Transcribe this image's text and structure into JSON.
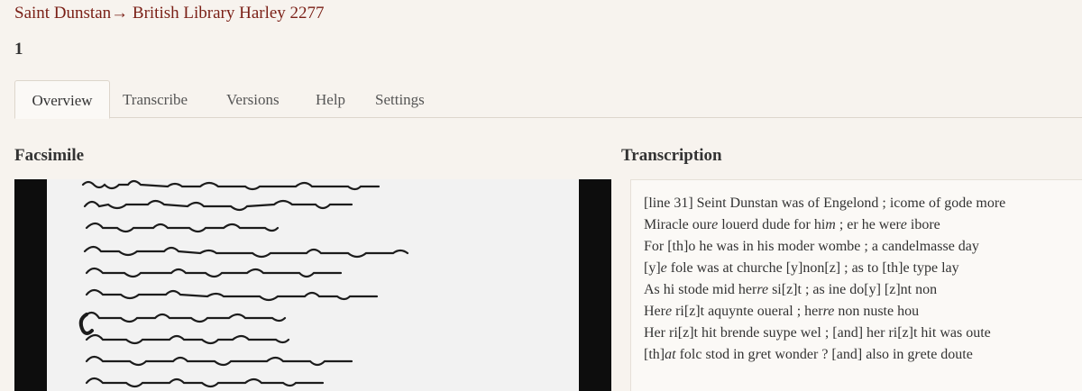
{
  "breadcrumb": {
    "collection": "Saint Dunstan",
    "arrow": "→",
    "work": "British Library Harley 2277"
  },
  "page_title": "1",
  "tabs": [
    {
      "label": "Overview",
      "active": true
    },
    {
      "label": "Transcribe",
      "active": false
    },
    {
      "label": "Versions",
      "active": false
    },
    {
      "label": "Help",
      "active": false
    },
    {
      "label": "Settings",
      "active": false
    }
  ],
  "facsimile": {
    "heading": "Facsimile"
  },
  "transcription": {
    "heading": "Transcription",
    "lines": [
      {
        "pre": "[line 31] Seint Dunstan was of Engelond ; icome of gode more",
        "it": "",
        "post": ""
      },
      {
        "pre": "Miracle our",
        "it": "e",
        "post": " louerd dude for hi",
        "it2": "m",
        "post2": " ; er he wer",
        "it3": "e",
        "post3": " ibore"
      },
      {
        "pre": "For [th]o he was in his moder wombe ; a candelmasse day",
        "it": "",
        "post": ""
      },
      {
        "pre": "[y]",
        "it": "e",
        "post": " fole was at churche [y]non[z] ; as to [th]e type lay"
      },
      {
        "pre": "As hi stode mid her",
        "it": "re",
        "post": " si[z]t ; as ine do[y] [z]nt non"
      },
      {
        "pre": "Her",
        "it": "e",
        "post": " ri[z]t aquynte oueral ; her",
        "it2": "re",
        "post2": " non nuste hou"
      },
      {
        "pre": "Her ri[z]t hit brende suype wel ; [and] her ri[z]t hit was oute",
        "it": "",
        "post": ""
      },
      {
        "pre": "[th]",
        "it": "at",
        "post": " folc stod in g",
        "it2": "r",
        "post2": "et wonder ? [and] also in g",
        "it3": "r",
        "post3": "ete doute"
      }
    ]
  }
}
